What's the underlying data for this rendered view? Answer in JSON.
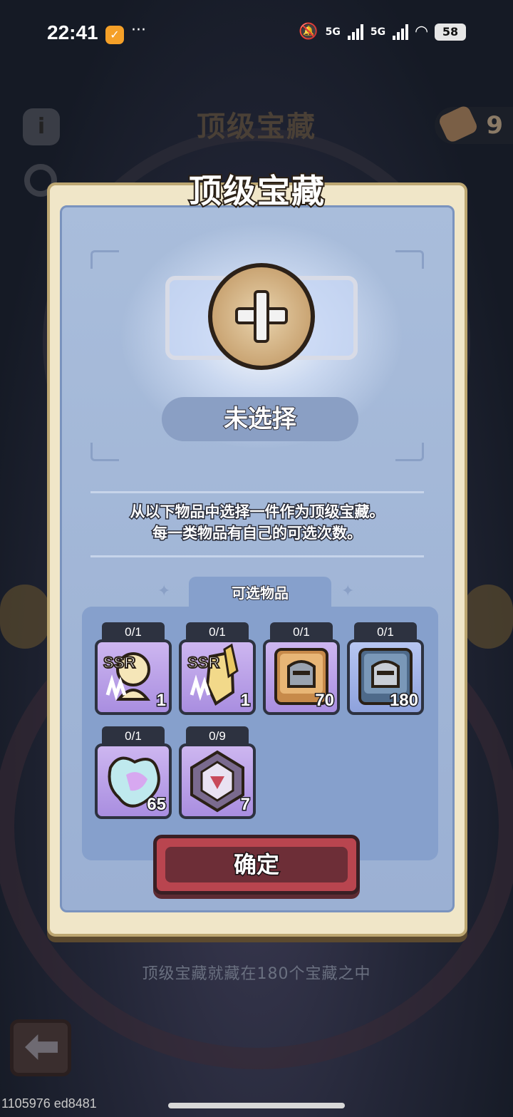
{
  "status_bar": {
    "time": "22:41",
    "notification_icon": "app-notification-icon",
    "overflow": "···",
    "net1": "5G",
    "net2": "5G",
    "battery": "58"
  },
  "background": {
    "title": "顶级宝藏",
    "hammer_count": "9",
    "bottom_text": "顶级宝藏就藏在180个宝藏之中",
    "debug_id": "1105976 ed8481"
  },
  "modal": {
    "title": "顶级宝藏",
    "selection_status": "未选择",
    "description_line1": "从以下物品中选择一件作为顶级宝藏。",
    "description_line2": "每一类物品有自己的可选次数。",
    "tab_label": "可选物品",
    "confirm_label": "确定",
    "items": [
      {
        "limit": "0/1",
        "qty": "1",
        "art": "ssr-hero-icon"
      },
      {
        "limit": "0/1",
        "qty": "1",
        "art": "ssr-armor-icon"
      },
      {
        "limit": "0/1",
        "qty": "70",
        "art": "gold-helmet-book-icon"
      },
      {
        "limit": "0/1",
        "qty": "180",
        "art": "silver-helmet-book-icon"
      },
      {
        "limit": "0/1",
        "qty": "65",
        "art": "crystal-shard-icon"
      },
      {
        "limit": "0/9",
        "qty": "7",
        "art": "rune-emblem-icon"
      }
    ]
  },
  "colors": {
    "modal_bg": "#9bb0d3",
    "frame": "#f0e6c8",
    "confirm": "#b9454f"
  }
}
